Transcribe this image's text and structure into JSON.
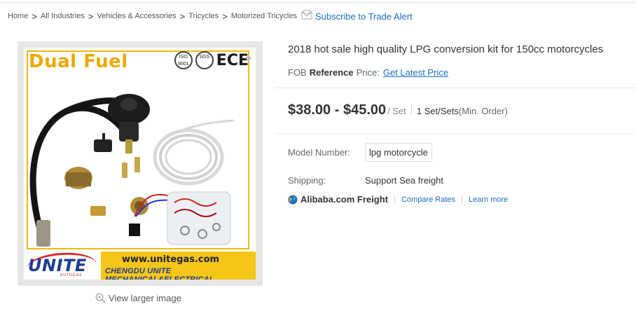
{
  "breadcrumb": {
    "items": [
      "Home",
      "All Industries",
      "Vehicles & Accessories",
      "Tricycles",
      "Motorized Tricycles"
    ],
    "separator": ">",
    "subscribe": "Subscribe to Trade Alert"
  },
  "product_image": {
    "badge": "Dual Fuel",
    "certs": [
      "ISO 9001",
      "SGS",
      "ECE"
    ],
    "brand_logo": "UNITE",
    "brand_logo_sub": "AUTOGAS",
    "website": "www.unitegas.com",
    "company": "CHENGDU UNITE MECHANICAL&ELECTRICAL",
    "view_larger": "View larger image"
  },
  "product": {
    "title": "2018 hot sale high quality LPG conversion kit for 150cc motorcycles",
    "fob_prefix": "FOB",
    "fob_bold": "Reference",
    "fob_suffix": "Price:",
    "latest_price_link": "Get Latest Price",
    "price": "$38.00 - $45.00",
    "price_unit": "/ Set",
    "moq": "1 Set/Sets",
    "moq_note": "(Min. Order)",
    "model_label": "Model Number:",
    "model_value": "lpg motorcycle",
    "shipping_label": "Shipping:",
    "shipping_value": "Support Sea freight",
    "freight_brand": "Alibaba.com Freight",
    "compare_rates": "Compare Rates",
    "learn_more": "Learn more"
  },
  "colors": {
    "link": "#1a6ec9",
    "accent_yellow": "#f5c518",
    "brand_blue": "#1d3d8f"
  }
}
